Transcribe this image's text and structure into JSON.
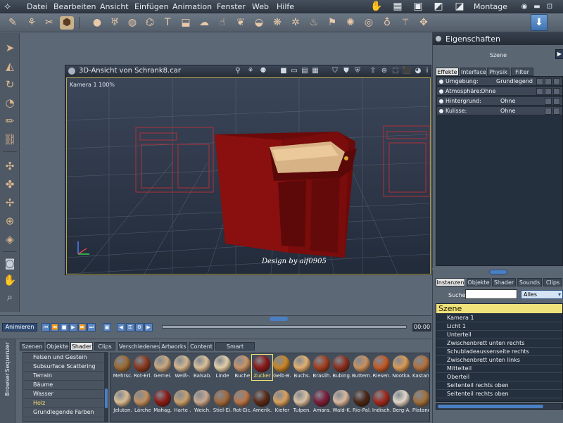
{
  "menubar": {
    "items": [
      "Datei",
      "Bearbeiten",
      "Ansicht",
      "Einfügen",
      "Animation",
      "Fenster",
      "Web",
      "Hilfe"
    ],
    "workspace_label": "Montage"
  },
  "view_window": {
    "title": "3D-Ansicht von Schrank8.car",
    "camera_label": "Kamera 1 100%",
    "signature": "Design by alf0905"
  },
  "properties": {
    "title": "Eigenschaften",
    "scene_label": "Szene",
    "tabs": [
      "Effekte",
      "Interface",
      "Physik",
      "Filter"
    ],
    "rows": [
      {
        "label": "Umgebung:",
        "value": "Grundlegend"
      },
      {
        "label": "Atmosphäre:",
        "value": "Ohne"
      },
      {
        "label": "Hintergrund:",
        "value": "Ohne"
      },
      {
        "label": "Kulisse:",
        "value": "Ohne"
      }
    ]
  },
  "instances": {
    "tabs": [
      "Instanzen",
      "Objekte",
      "Shader",
      "Sounds",
      "Clips"
    ],
    "search_label": "Suche:",
    "search_value": "",
    "filter_value": "Alles",
    "header": "Szene",
    "items": [
      "Kamera 1",
      "Licht 1",
      "Unterteil",
      "Zwischenbrett unten rechts",
      "Schubladeaussenseite rechts",
      "Zwischenbrett unten links",
      "Mittelteil",
      "Oberteil",
      "Seitenteil rechts oben",
      "Seitenteil rechts oben"
    ]
  },
  "timeline": {
    "animate_label": "Animieren",
    "time_value": "00:00"
  },
  "library": {
    "vertical_tabs": [
      "Browser",
      "Sequenzer"
    ],
    "tabs": [
      "Szenen",
      "Objekte",
      "Shader",
      "Clips",
      "Verschiedenes",
      "Artworks",
      "Content",
      "Smart Content"
    ],
    "categories": [
      "Felsen und Gestein",
      "Subsurface Scattering",
      "Terrain",
      "Bäume",
      "Wasser",
      "Holz",
      "Grundlegende Farben"
    ],
    "selected_category": "Holz",
    "swatches_row1": [
      {
        "label": "Mehrsc.",
        "color": "#9a6a34"
      },
      {
        "label": "Rot-Erl.",
        "color": "#8a3a20"
      },
      {
        "label": "Gernei.",
        "color": "#c8a880"
      },
      {
        "label": "Weiß-.",
        "color": "#d2b690"
      },
      {
        "label": "Balsab.",
        "color": "#d8c09a"
      },
      {
        "label": "Linde",
        "color": "#e2ceaa"
      },
      {
        "label": "Buche",
        "color": "#c89468"
      },
      {
        "label": "Zucker",
        "color": "#8a1a1a"
      },
      {
        "label": "Gelb-B.",
        "color": "#c8862a"
      },
      {
        "label": "Buchs.",
        "color": "#e0b070"
      },
      {
        "label": "Brasilh.",
        "color": "#a04020"
      },
      {
        "label": "Bubing.",
        "color": "#8a3020"
      },
      {
        "label": "Buttern.",
        "color": "#c89060"
      },
      {
        "label": "Riesen.",
        "color": "#c05a28"
      },
      {
        "label": "Nootka.",
        "color": "#d89a58"
      },
      {
        "label": "Kastan.",
        "color": "#b07040"
      }
    ],
    "swatches_row2": [
      {
        "label": "Jeluton.",
        "color": "#d8bc94"
      },
      {
        "label": "Lärche",
        "color": "#c09060"
      },
      {
        "label": "Mahag.",
        "color": "#8c1c18"
      },
      {
        "label": "Harte .",
        "color": "#c8a070"
      },
      {
        "label": "Weich.",
        "color": "#c8a890"
      },
      {
        "label": "Stiel-Ei.",
        "color": "#a06a3c"
      },
      {
        "label": "Rot-Eic.",
        "color": "#b8764a"
      },
      {
        "label": "Amerik.",
        "color": "#5a2a18"
      },
      {
        "label": "Kiefer",
        "color": "#d8a060"
      },
      {
        "label": "Tulpen.",
        "color": "#d8c0a0"
      },
      {
        "label": "Amara.",
        "color": "#7a1e3a"
      },
      {
        "label": "Wald-K.",
        "color": "#d8b8a0"
      },
      {
        "label": "Rio-Pal.",
        "color": "#4a2818"
      },
      {
        "label": "Indisch.",
        "color": "#a02a20"
      },
      {
        "label": "Berg-A.",
        "color": "#e0d6c8"
      },
      {
        "label": "Platane",
        "color": "#a0703c"
      }
    ]
  }
}
